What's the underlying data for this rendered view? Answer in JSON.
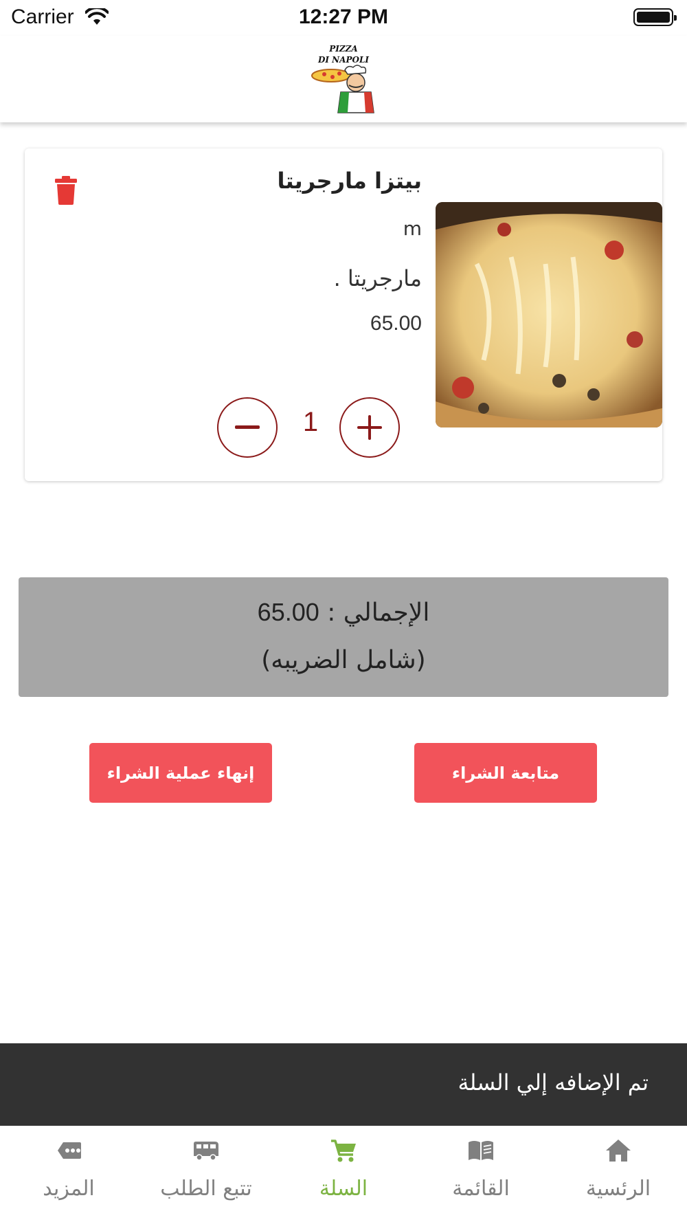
{
  "status_bar": {
    "carrier": "Carrier",
    "time": "12:27 PM"
  },
  "header": {
    "logo_line1": "PIZZA",
    "logo_line2": "DI NAPOLI"
  },
  "cart": {
    "items": [
      {
        "name": "بيتزا مارجريتا",
        "size": "m",
        "description": "مارجريتا .",
        "price": "65.00",
        "quantity": "1"
      }
    ]
  },
  "summary": {
    "total_label": "الإجمالي : ",
    "total_value": "65.00",
    "tax_note": "(شامل الضريبه)"
  },
  "actions": {
    "finish_label": "إنهاء عملية الشراء",
    "continue_label": "متابعة الشراء"
  },
  "toast": {
    "message": "تم الإضافه إلي السلة"
  },
  "tab_bar": {
    "active_tab": "cart",
    "tabs": [
      {
        "id": "more",
        "label": "المزيد",
        "icon": "more-icon"
      },
      {
        "id": "track",
        "label": "تتبع الطلب",
        "icon": "delivery-van-icon"
      },
      {
        "id": "cart",
        "label": "السلة",
        "icon": "cart-icon"
      },
      {
        "id": "menu",
        "label": "القائمة",
        "icon": "book-icon"
      },
      {
        "id": "home",
        "label": "الرئسية",
        "icon": "home-icon"
      }
    ]
  },
  "colors": {
    "accent_button": "#f2535a",
    "delete_icon": "#e53935",
    "quantity": "#8b1a1a",
    "tab_active": "#7cb342",
    "tab_inactive": "#808080",
    "summary_bg": "#a6a6a6",
    "toast_bg": "#323232"
  }
}
